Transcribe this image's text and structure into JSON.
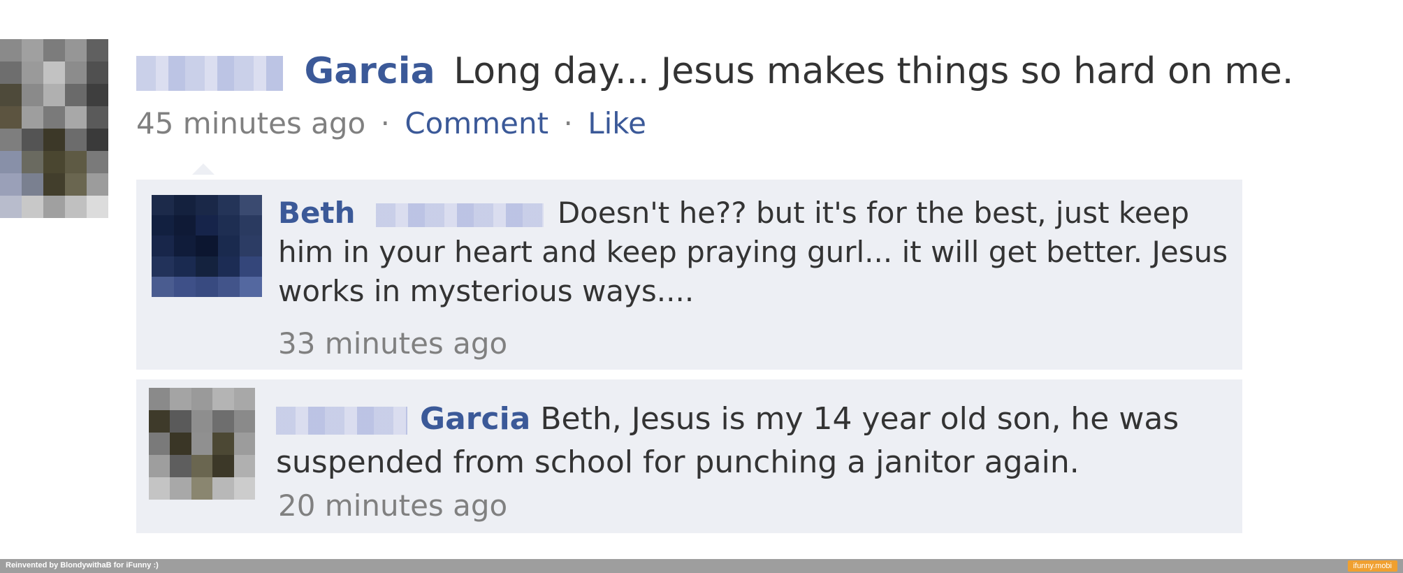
{
  "status": {
    "author_name": "Garcia",
    "text": "Long day... Jesus makes things so hard on me.",
    "time": "45 minutes ago",
    "separator": "·",
    "comment_label": "Comment",
    "like_label": "Like"
  },
  "comments": [
    {
      "author_name": "Beth",
      "text": "Doesn't he?? but it's for the best, just keep him in your heart and keep praying gurl... it will get better. Jesus works in mysterious ways....",
      "time": "33 minutes ago"
    },
    {
      "author_name": "Garcia",
      "text": "Beth, Jesus is my 14 year old son, he was suspended from school for punching a janitor again.",
      "time": "20 minutes ago"
    }
  ],
  "footer": {
    "credit": "Reinvented by BlondywithaB for iFunny :)",
    "watermark": "ifunny.mobi"
  },
  "colors": {
    "name_link": "#3b5998",
    "comment_bg": "#edeff4",
    "meta_gray": "#808080"
  }
}
